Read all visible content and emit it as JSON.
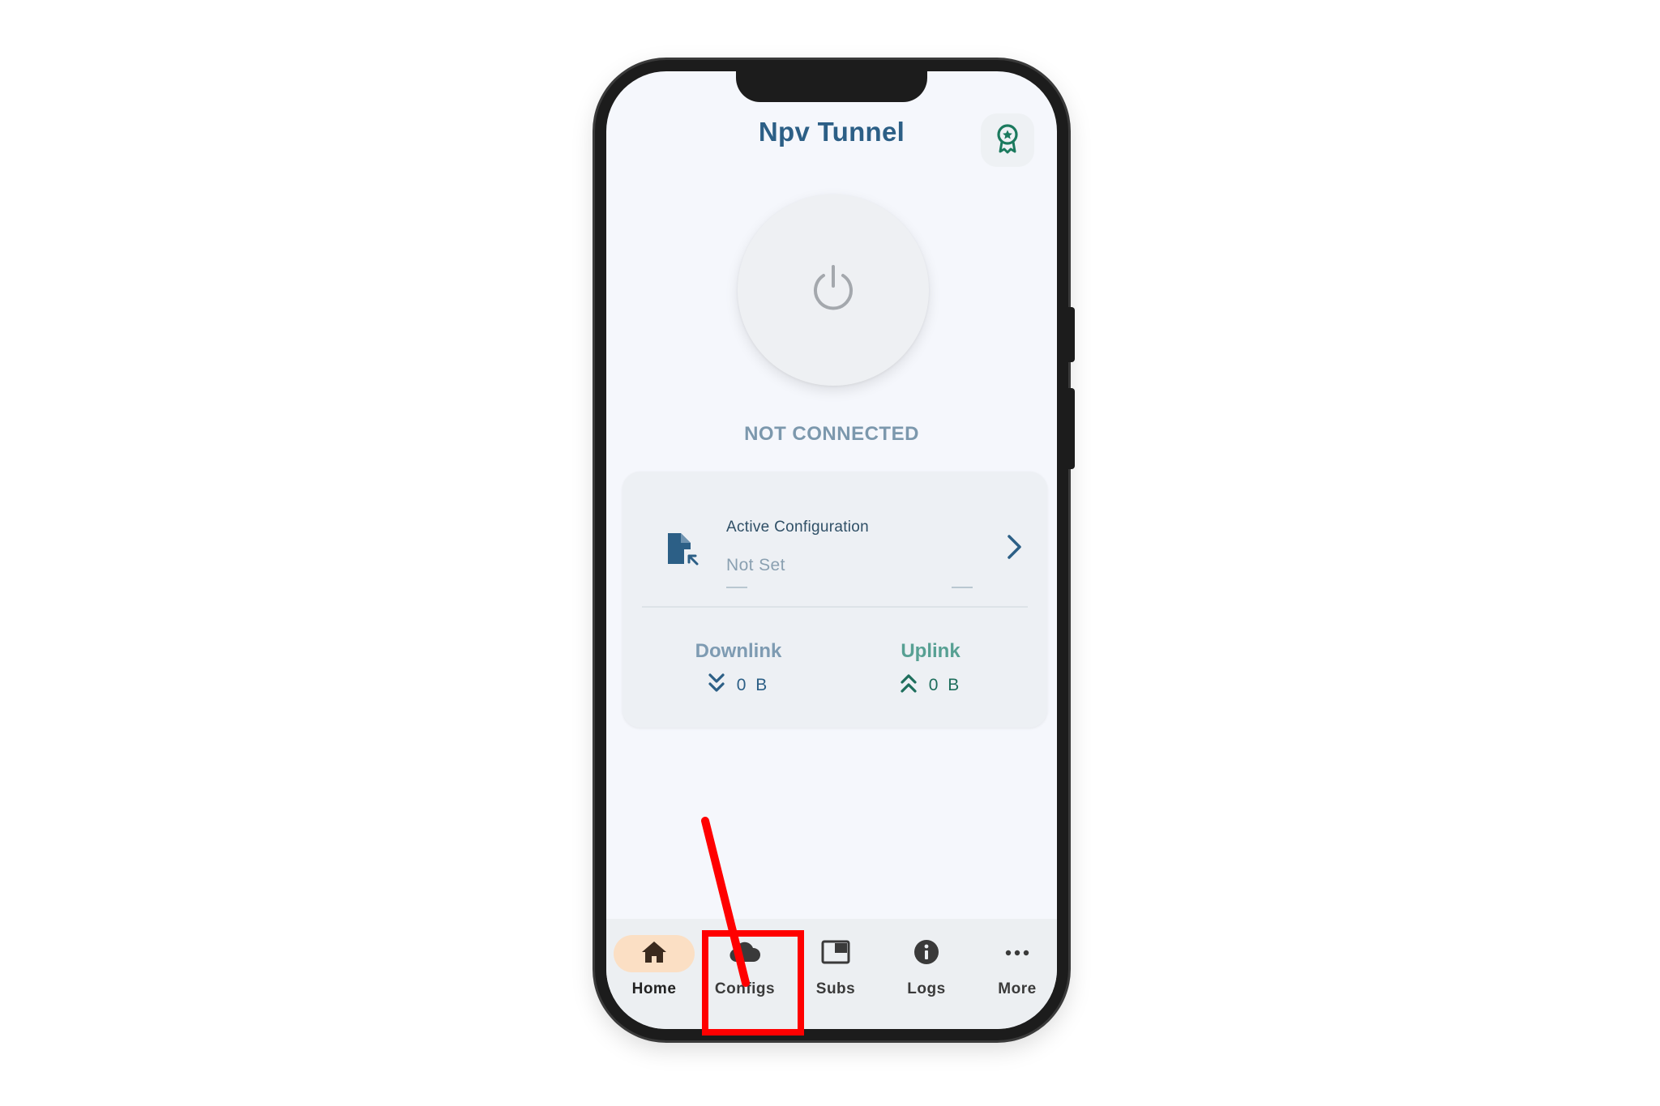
{
  "header": {
    "title": "Npv Tunnel",
    "award_icon": "award-badge-icon"
  },
  "power": {
    "icon": "power-icon",
    "status": "NOT CONNECTED"
  },
  "config_card": {
    "label": "Active Configuration",
    "value": "Not Set",
    "file_icon": "file-import-icon",
    "chevron_icon": "chevron-right-icon"
  },
  "stats": {
    "downlink": {
      "label": "Downlink",
      "value": "0 B",
      "icon": "double-chevron-down-icon"
    },
    "uplink": {
      "label": "Uplink",
      "value": "0 B",
      "icon": "double-chevron-up-icon"
    }
  },
  "nav": {
    "items": [
      {
        "label": "Home",
        "icon": "home-icon",
        "active": true
      },
      {
        "label": "Configs",
        "icon": "cloud-icon",
        "active": false
      },
      {
        "label": "Subs",
        "icon": "subscription-window-icon",
        "active": false
      },
      {
        "label": "Logs",
        "icon": "info-icon",
        "active": false
      },
      {
        "label": "More",
        "icon": "more-dots-icon",
        "active": false
      }
    ]
  },
  "colors": {
    "title": "#2c5f86",
    "status": "#7c98ad",
    "uplink": "#57a093",
    "active_nav": "#fbdfc4",
    "annotation": "#ff0000"
  },
  "annotation": {
    "type": "red-arrow-and-box",
    "target": "Configs"
  }
}
